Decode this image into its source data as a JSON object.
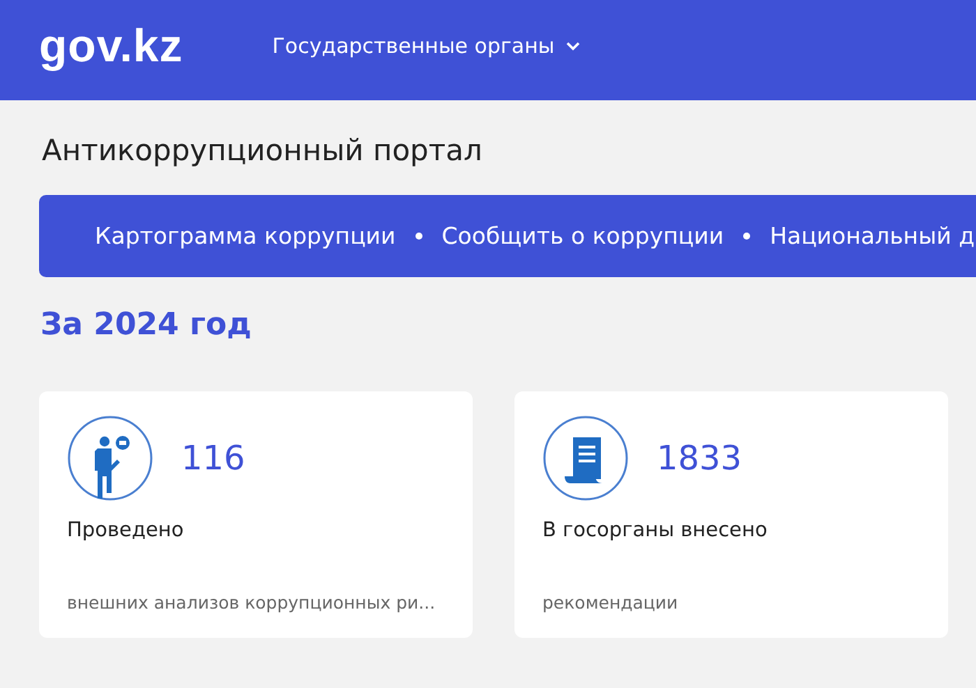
{
  "header": {
    "logo": "gov.kz",
    "menu": "Государственные органы"
  },
  "page_title": "Антикоррупционный портал",
  "nav": [
    "Картограмма коррупции",
    "Сообщить о коррупции",
    "Национальный д"
  ],
  "section_title": "За 2024 год",
  "cards": [
    {
      "kind": "person",
      "value": "116",
      "label": "Проведено",
      "caption": "внешних анализов коррупционных ри..."
    },
    {
      "kind": "document",
      "value": "1833",
      "label": "В госорганы внесено",
      "caption": "рекомендации"
    }
  ]
}
